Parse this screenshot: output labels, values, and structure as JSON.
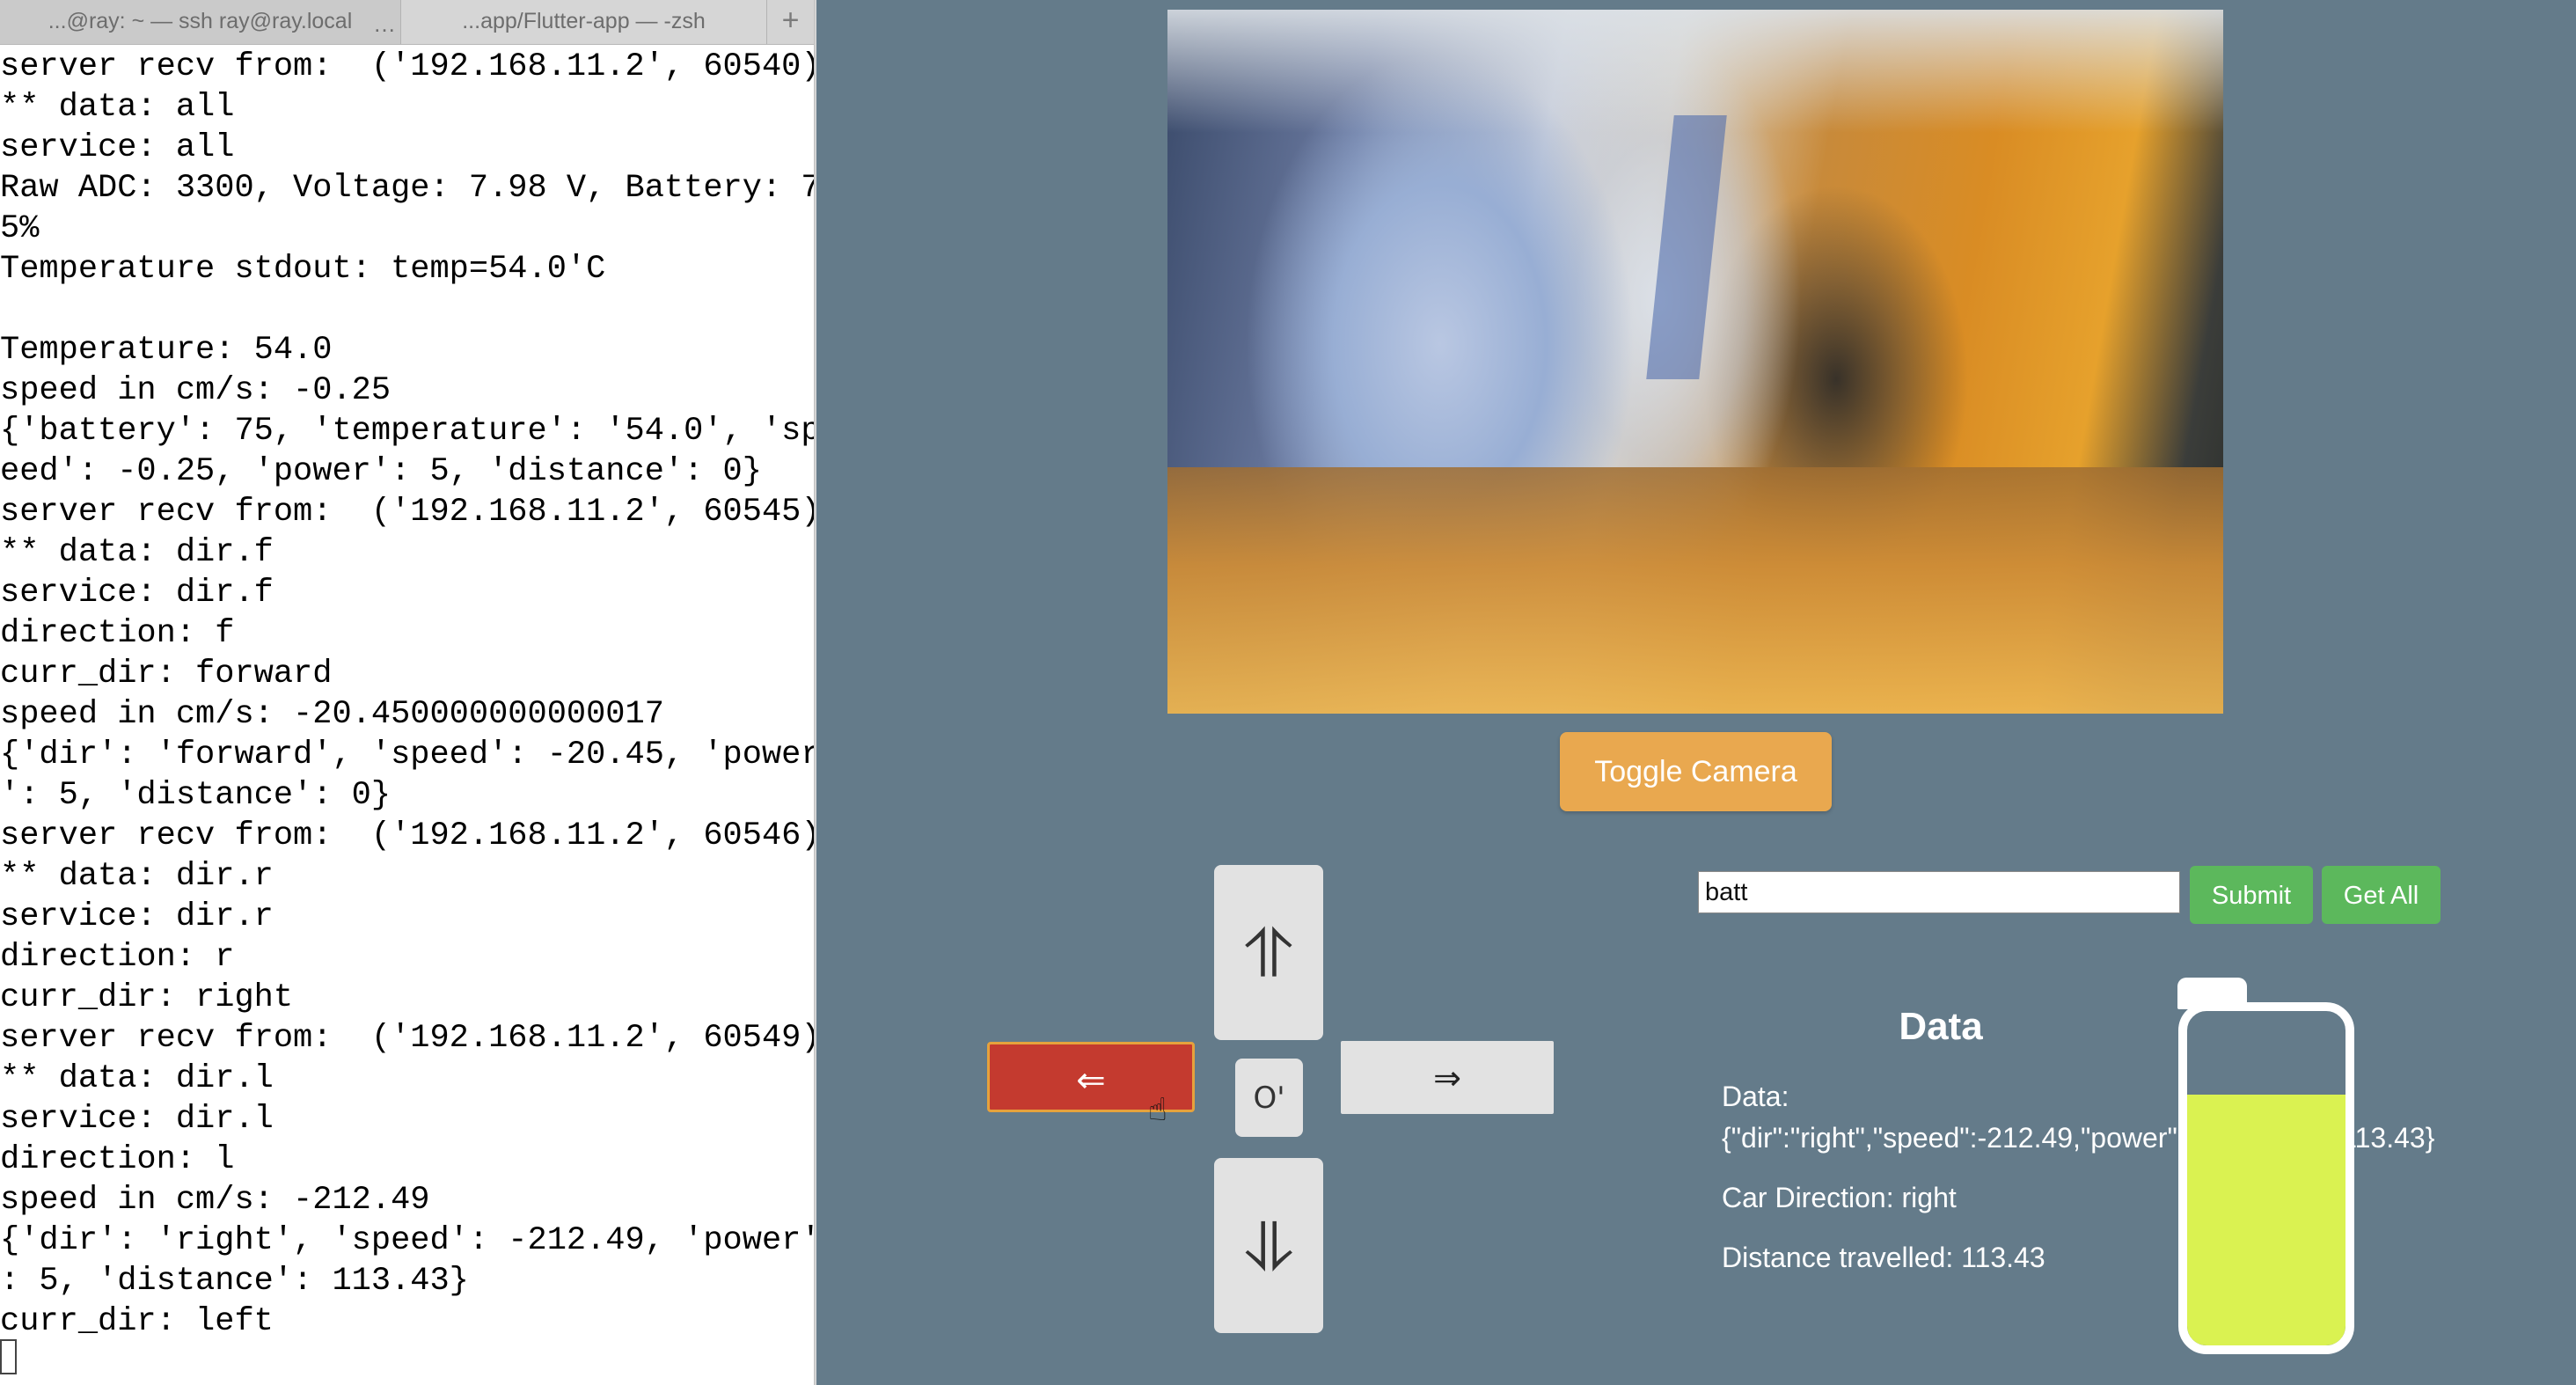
{
  "terminal": {
    "tabs": [
      {
        "label": "...@ray: ~ — ssh ray@ray.local",
        "close": "…"
      },
      {
        "label": "...app/Flutter-app — -zsh"
      }
    ],
    "add_tab": "+",
    "lines": [
      "server recv from:  ('192.168.11.2', 60540)",
      "** data: all",
      "service: all",
      "Raw ADC: 3300, Voltage: 7.98 V, Battery: 7",
      "5%",
      "Temperature stdout: temp=54.0'C",
      "",
      "Temperature: 54.0",
      "speed in cm/s: -0.25",
      "{'battery': 75, 'temperature': '54.0', 'sp",
      "eed': -0.25, 'power': 5, 'distance': 0}",
      "server recv from:  ('192.168.11.2', 60545)",
      "** data: dir.f",
      "service: dir.f",
      "direction: f",
      "curr_dir: forward",
      "speed in cm/s: -20.450000000000017",
      "{'dir': 'forward', 'speed': -20.45, 'power",
      "': 5, 'distance': 0}",
      "server recv from:  ('192.168.11.2', 60546)",
      "** data: dir.r",
      "service: dir.r",
      "direction: r",
      "curr_dir: right",
      "server recv from:  ('192.168.11.2', 60549)",
      "** data: dir.l",
      "service: dir.l",
      "direction: l",
      "speed in cm/s: -212.49",
      "{'dir': 'right', 'speed': -212.49, 'power'",
      ": 5, 'distance': 113.43}",
      "curr_dir: left"
    ]
  },
  "app": {
    "toggle_camera_label": "Toggle Camera",
    "controls": {
      "up": "⥣",
      "down": "⥥",
      "left": "⇐",
      "right": "⇒",
      "stop": "O'"
    },
    "query": {
      "value": "batt",
      "submit_label": "Submit",
      "get_all_label": "Get All"
    },
    "data_panel": {
      "title": "Data",
      "data_label": "Data:",
      "data_json": "{\"dir\":\"right\",\"speed\":-212.49,\"power\":5,\"distance\":113.43}",
      "car_direction": "Car Direction: right",
      "distance": "Distance travelled: 113.43"
    },
    "battery_level": 0.75,
    "colors": {
      "background": "#647b8a",
      "toggle_button": "#e9a84f",
      "active_left_button": "#c43a2f",
      "green_buttons": "#5cb85c",
      "battery_fill": "#daf251"
    }
  }
}
